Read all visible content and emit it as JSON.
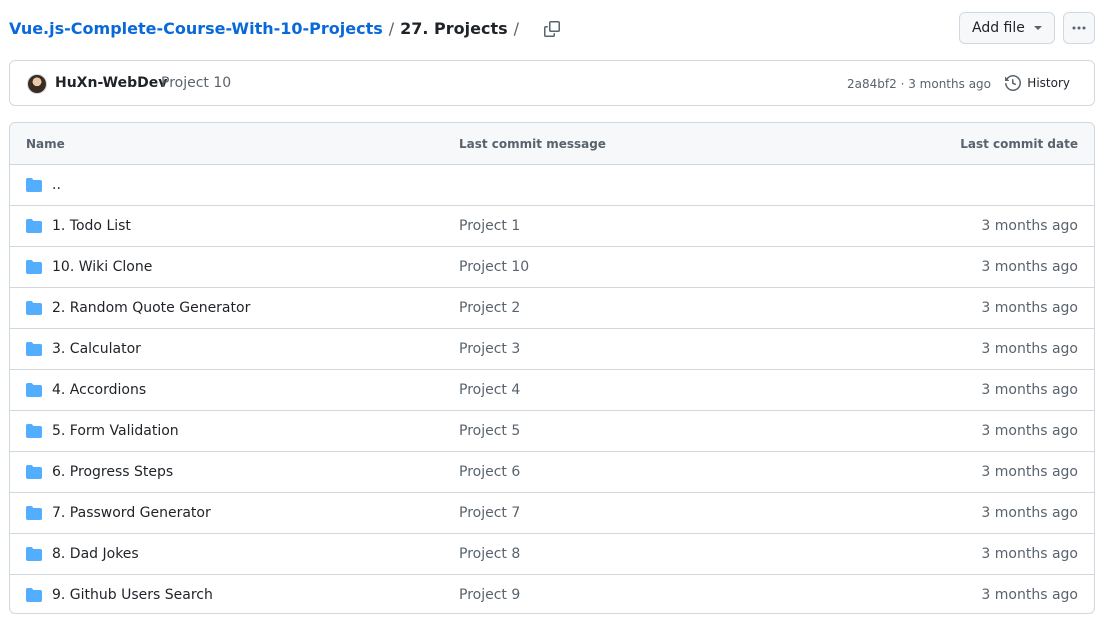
{
  "breadcrumb": {
    "repo": "Vue.js-Complete-Course-With-10-Projects",
    "separator": "/",
    "current": "27. Projects",
    "trailing": "/"
  },
  "actions": {
    "add_file": "Add file"
  },
  "commit": {
    "author": "HuXn-WebDev",
    "message": "Project 10",
    "meta": "2a84bf2 · 3 months ago",
    "history": "History"
  },
  "table": {
    "headers": {
      "name": "Name",
      "message": "Last commit message",
      "date": "Last commit date"
    },
    "parent": "..",
    "rows": [
      {
        "name": "1. Todo List",
        "message": "Project 1",
        "date": "3 months ago"
      },
      {
        "name": "10. Wiki Clone",
        "message": "Project 10",
        "date": "3 months ago"
      },
      {
        "name": "2. Random Quote Generator",
        "message": "Project 2",
        "date": "3 months ago"
      },
      {
        "name": "3. Calculator",
        "message": "Project 3",
        "date": "3 months ago"
      },
      {
        "name": "4. Accordions",
        "message": "Project 4",
        "date": "3 months ago"
      },
      {
        "name": "5. Form Validation",
        "message": "Project 5",
        "date": "3 months ago"
      },
      {
        "name": "6. Progress Steps",
        "message": "Project 6",
        "date": "3 months ago"
      },
      {
        "name": "7. Password Generator",
        "message": "Project 7",
        "date": "3 months ago"
      },
      {
        "name": "8. Dad Jokes",
        "message": "Project 8",
        "date": "3 months ago"
      },
      {
        "name": "9. Github Users Search",
        "message": "Project 9",
        "date": "3 months ago"
      }
    ]
  },
  "colors": {
    "link": "#0969da",
    "folder": "#54aeff",
    "muted": "#59636e",
    "border": "#d1d9e0"
  },
  "icons": [
    "copy-icon",
    "triangle-down-icon",
    "kebab-horizontal-icon",
    "history-icon",
    "folder-icon"
  ]
}
